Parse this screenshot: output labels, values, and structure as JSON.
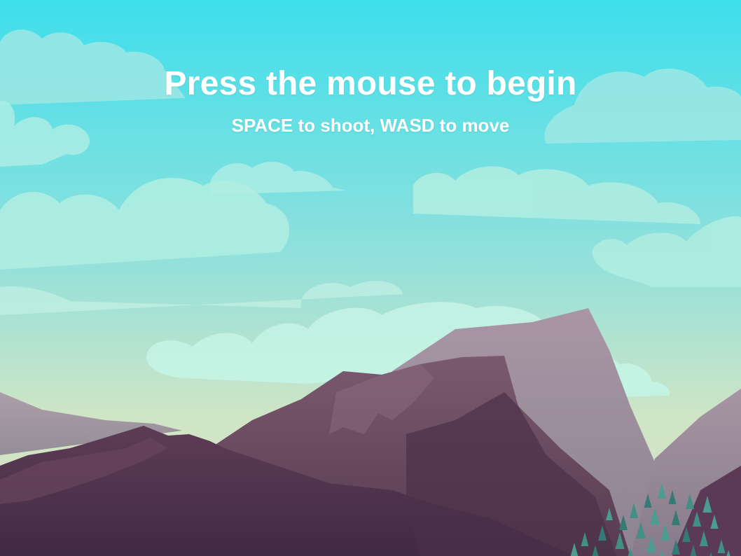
{
  "screen": {
    "headline": "Press the mouse to begin",
    "instructions": "SPACE to shoot, WASD to move"
  },
  "scene": {
    "sky_top_color": "#3ddfec",
    "sky_mid_color": "#9ae1d8",
    "sky_horizon_color": "#cfe5c6",
    "cloud_color": "#b7f0e8",
    "mountain_far_color": "#9c8a9a",
    "mountain_mid_color": "#6b4a5e",
    "mountain_near_color": "#4a2e48",
    "tree_color": "#3f8a82"
  }
}
